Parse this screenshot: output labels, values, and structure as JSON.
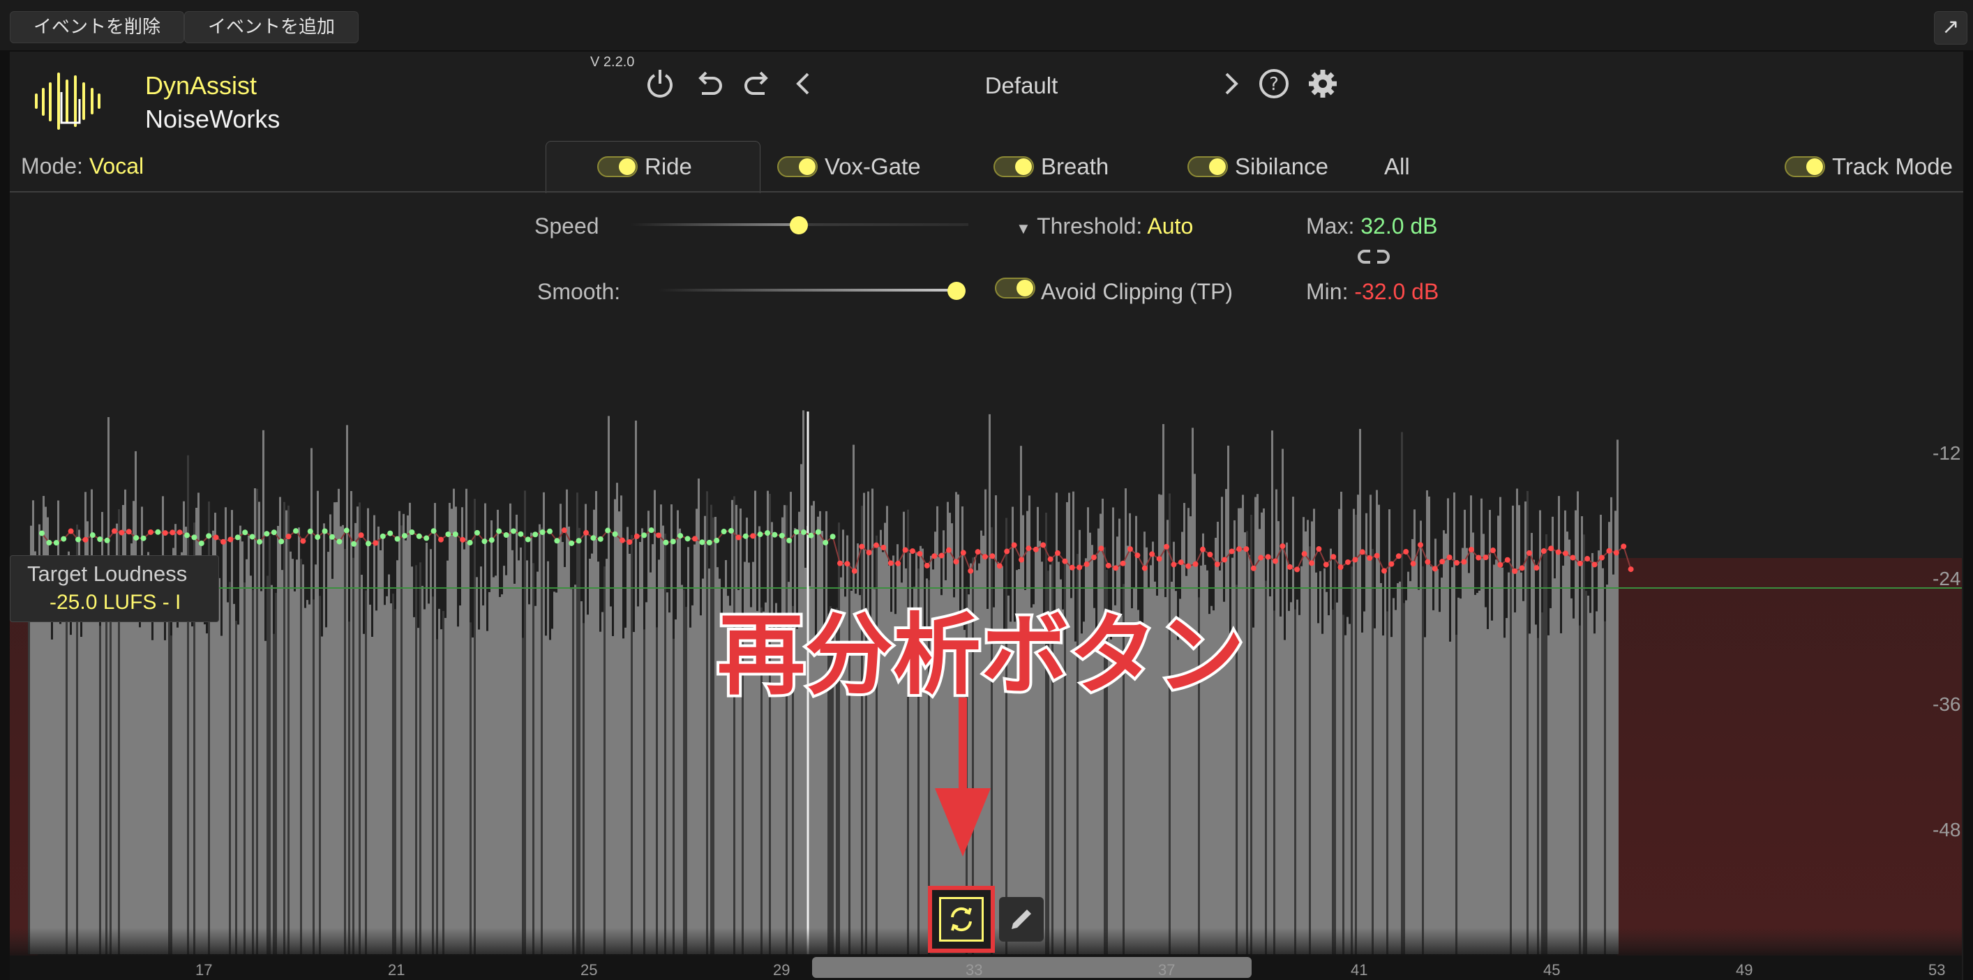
{
  "host": {
    "delete_event": "イベントを削除",
    "add_event": "イベントを追加"
  },
  "plugin": {
    "version": "V 2.2.0",
    "brand_line1": "DynAssist",
    "brand_line2": "NoiseWorks",
    "preset": "Default",
    "mode_label": "Mode:",
    "mode_value": "Vocal",
    "tabs": [
      "Ride",
      "Vox-Gate",
      "Breath",
      "Sibilance",
      "All"
    ],
    "track_mode": "Track Mode",
    "speed_label": "Speed",
    "speed_value": 0.5,
    "smooth_label": "Smooth:",
    "smooth_value": 1.0,
    "threshold_label": "Threshold:",
    "threshold_value": "Auto",
    "avoid_clipping": "Avoid Clipping (TP)",
    "max_label": "Max:",
    "max_value": "32.0 dB",
    "min_label": "Min:",
    "min_value": "-32.0 dB",
    "target_label": "Target Loudness",
    "target_value": "-25.0 LUFS - I",
    "db_axis": [
      "-12",
      "-24",
      "-36",
      "-48"
    ],
    "ruler": [
      "17",
      "21",
      "25",
      "29",
      "33",
      "37",
      "41",
      "45",
      "49",
      "53"
    ]
  },
  "annotation": {
    "callout_text": "再分析ボタン"
  },
  "colors": {
    "accent_yellow": "#fff86f",
    "max_green": "#8cf58f",
    "min_red": "#ff4a4a",
    "annotation_red": "#e5383b"
  }
}
